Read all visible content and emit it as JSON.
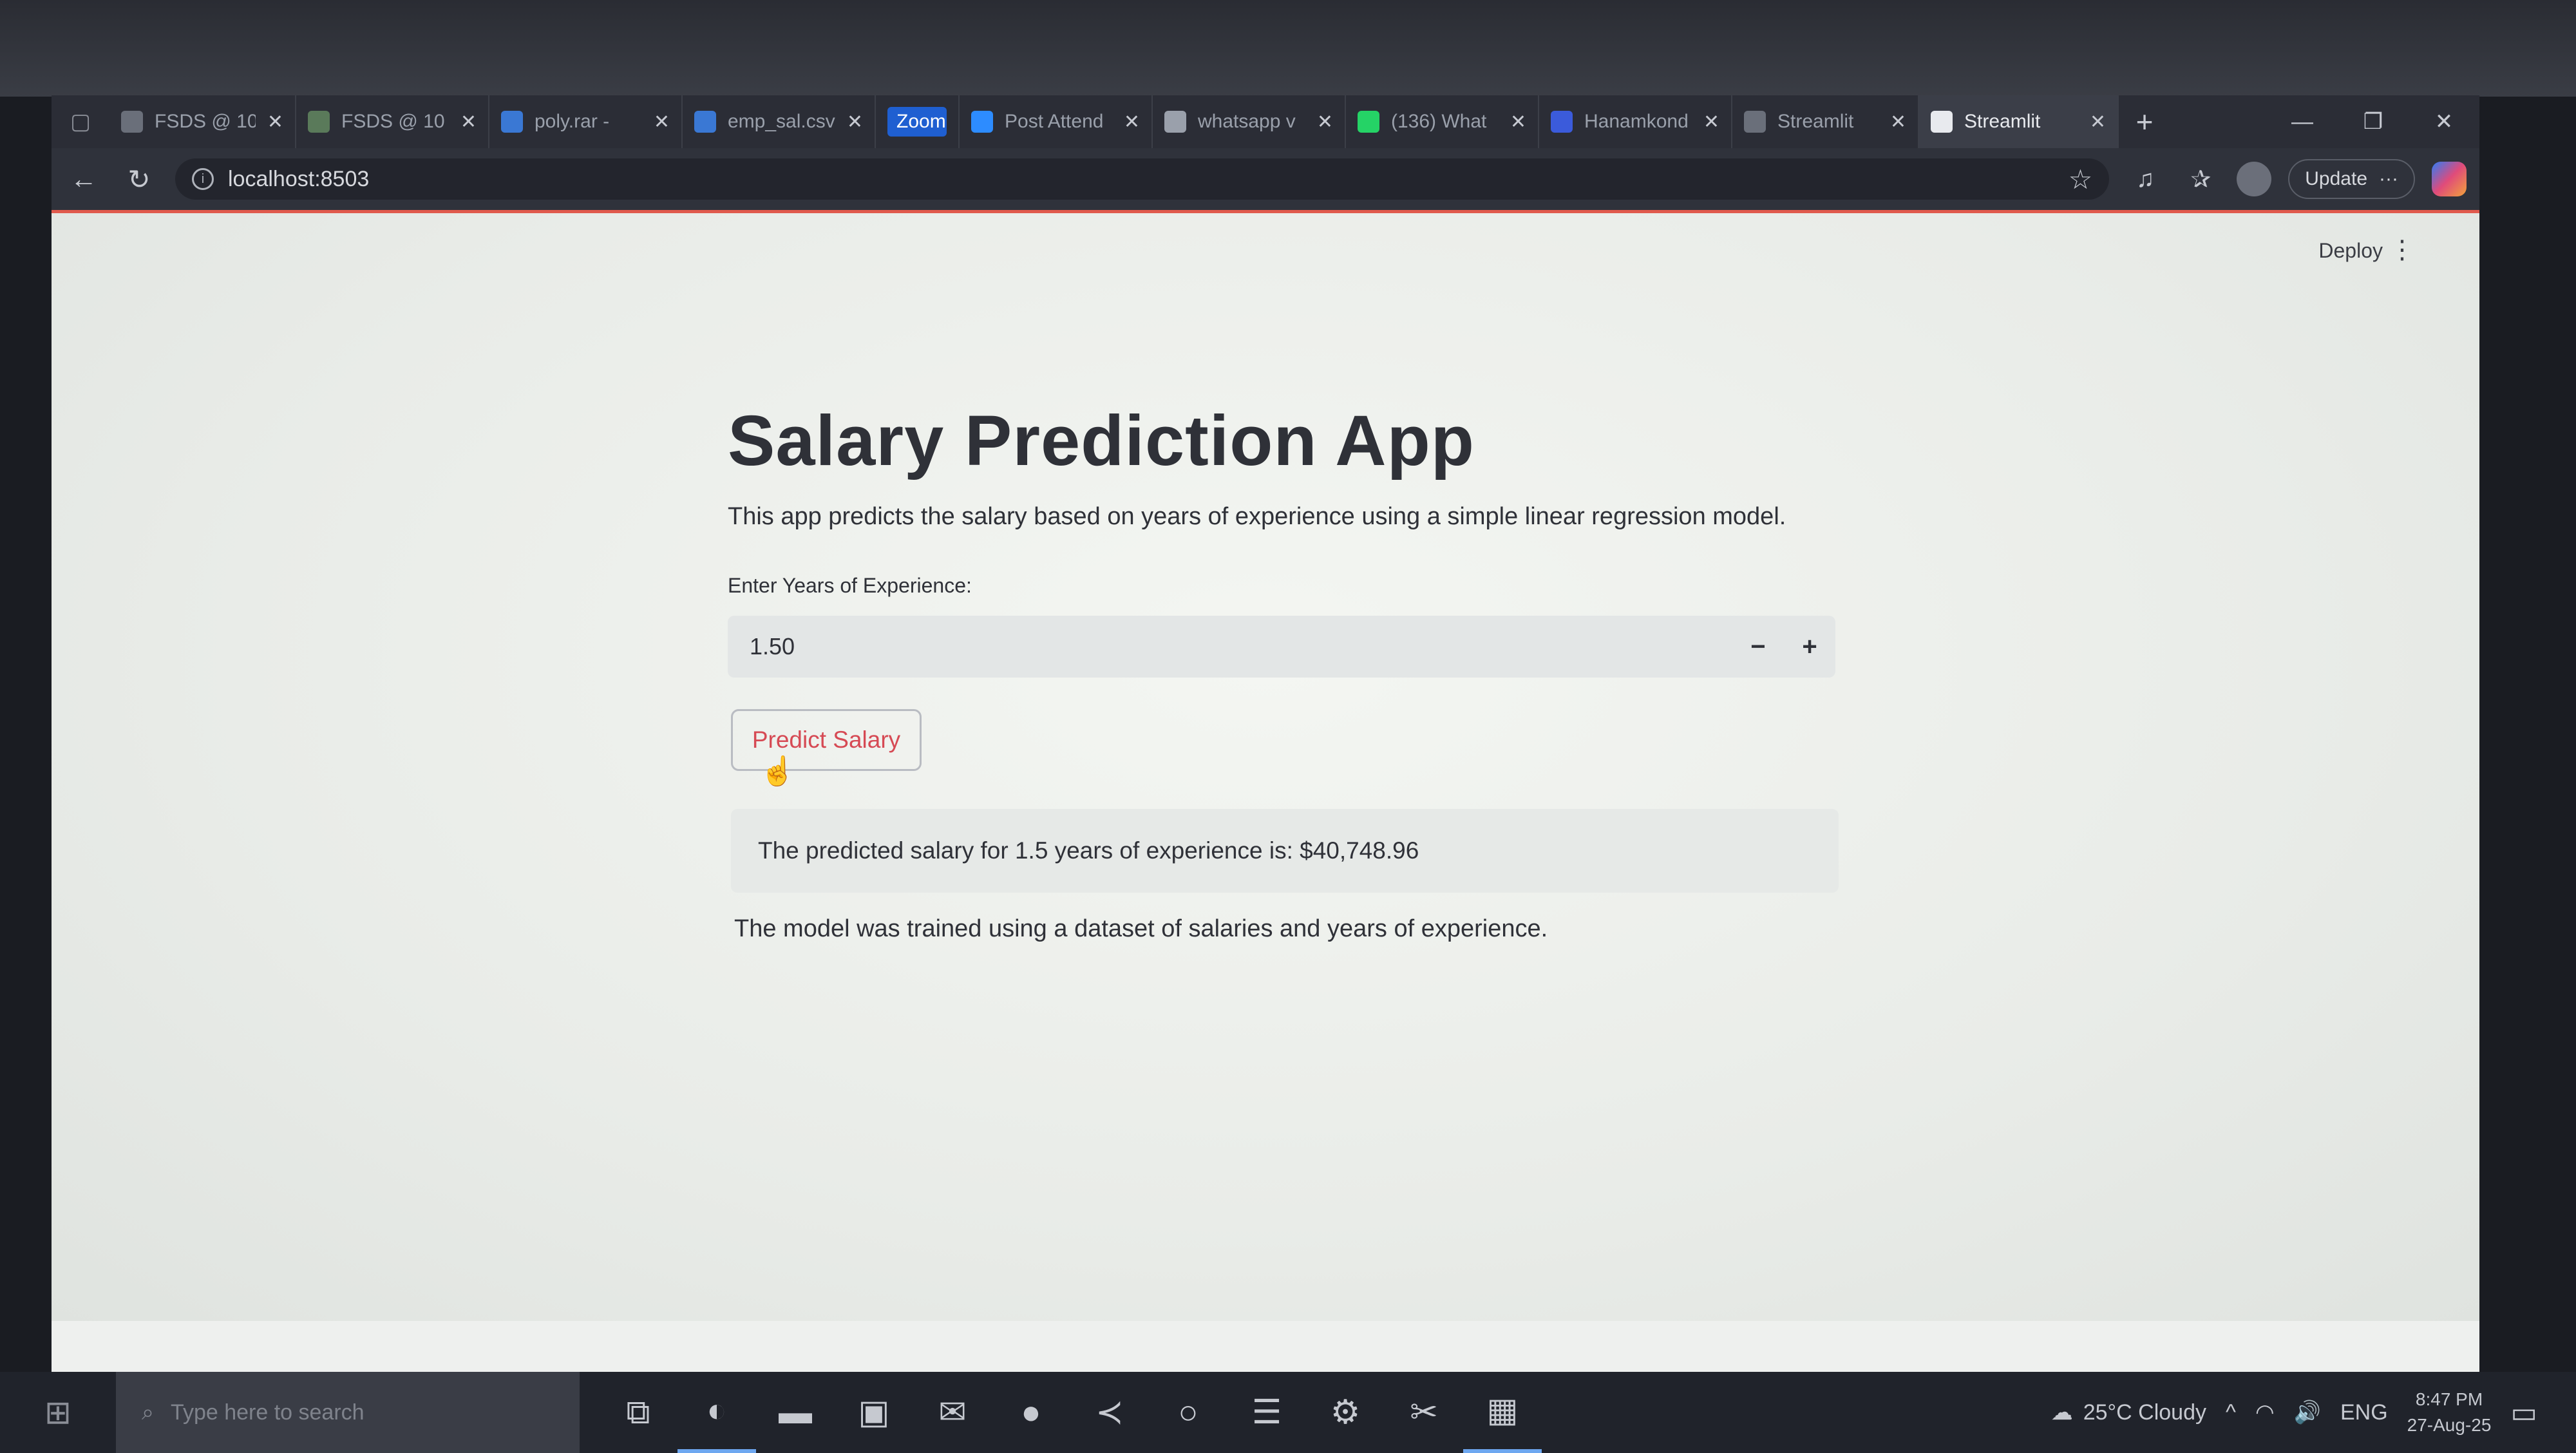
{
  "browser": {
    "tabs": [
      {
        "title": "FSDS @ 10",
        "icon": "document-icon",
        "color": "#6a6f7a"
      },
      {
        "title": "FSDS @ 10",
        "icon": "classroom-icon",
        "color": "#5a7a5a"
      },
      {
        "title": "poly.rar - ",
        "icon": "drive-icon",
        "color": "#3a78d4"
      },
      {
        "title": "emp_sal.csv",
        "icon": "drive-icon",
        "color": "#3a78d4"
      },
      {
        "title": "Zoom",
        "icon": "",
        "color": "#1f5fd1"
      },
      {
        "title": "Post Attend",
        "icon": "zoom-icon",
        "color": "#2d8cff"
      },
      {
        "title": "whatsapp v",
        "icon": "search-icon",
        "color": "#9aa0ab"
      },
      {
        "title": "(136) What",
        "icon": "whatsapp-icon",
        "color": "#25d366"
      },
      {
        "title": "Hanamkond",
        "icon": "butterfly-icon",
        "color": "#3b5bdb"
      },
      {
        "title": "Streamlit",
        "icon": "streamlit-icon",
        "color": "#6a6f7a"
      },
      {
        "title": "Streamlit",
        "icon": "streamlit-icon",
        "color": "#e8eaee"
      }
    ],
    "active_tab_index": 10,
    "url": "localhost:8503",
    "update_label": "Update"
  },
  "app": {
    "deploy_label": "Deploy",
    "title": "Salary Prediction App",
    "description": "This app predicts the salary based on years of experience using a simple linear regression model.",
    "input_label": "Enter Years of Experience:",
    "input_value": "1.50",
    "minus_label": "−",
    "plus_label": "+",
    "button_label": "Predict Salary",
    "result_text": "The predicted salary for 1.5 years of experience is: $40,748.96",
    "footer_text": "The model was trained using a dataset of salaries and years of experience.",
    "accent_color": "#d64a54"
  },
  "taskbar": {
    "search_placeholder": "Type here to search",
    "weather": "25°C  Cloudy",
    "language": "ENG",
    "time": "8:47 PM",
    "date": "27-Aug-25"
  }
}
